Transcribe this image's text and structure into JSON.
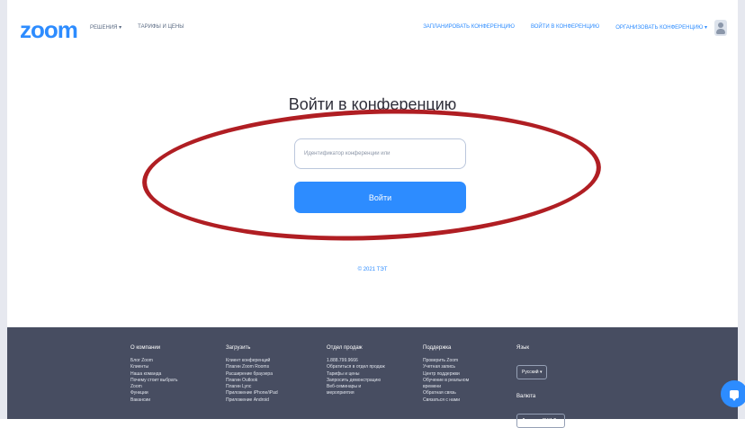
{
  "header": {
    "logo": "zoom",
    "nav_left": [
      "РЕШЕНИЯ ▾",
      "ТАРИФЫ И ЦЕНЫ"
    ],
    "nav_right": [
      "ЗАПЛАНИРОВАТЬ КОНФЕРЕНЦИЮ",
      "ВОЙТИ В КОНФЕРЕНЦИЮ",
      "ОРГАНИЗОВАТЬ КОНФЕРЕНЦИЮ ▾"
    ]
  },
  "main": {
    "title": "Войти в конференцию",
    "input_placeholder": "Идентификатор конференции или",
    "join_button": "Войти",
    "small_link": "© 2021 ТЭТ"
  },
  "footer": {
    "columns": [
      {
        "heading": "О компании",
        "items": [
          "Блог Zoom",
          "Клиенты",
          "Наша команда",
          "Почему стоит выбрать",
          "Zoom",
          "Функции",
          "Вакансии"
        ]
      },
      {
        "heading": "Загрузить",
        "items": [
          "Клиент конференций",
          "Плагин Zoom Rooms",
          "Расширение браузера",
          "Плагин Outlook",
          "Плагин Lync",
          "Приложение iPhone/iPad",
          "Приложение Android"
        ]
      },
      {
        "heading": "Отдел продаж",
        "items": [
          "1.888.799.9666",
          "Обратиться в отдел продаж",
          "Тарифы и цены",
          "Запросить демонстрацию",
          "Веб-семинары и",
          "мероприятия"
        ]
      },
      {
        "heading": "Поддержка",
        "items": [
          "Проверить Zoom",
          "Учетная запись",
          "Центр поддержки",
          "Обучение в реальном",
          "времени",
          "Обратная связь",
          "Связаться с нами"
        ]
      }
    ],
    "language": {
      "heading": "Язык",
      "value": "Русский ▾"
    },
    "currency": {
      "heading": "Валюта",
      "value": "Доллары США $ ▾"
    }
  },
  "colors": {
    "brand_blue": "#2d8cff",
    "footer_bg": "#474d61",
    "annotation_red": "#b01e23"
  },
  "icons": {
    "avatar": "user-icon",
    "chat": "chat-icon"
  }
}
